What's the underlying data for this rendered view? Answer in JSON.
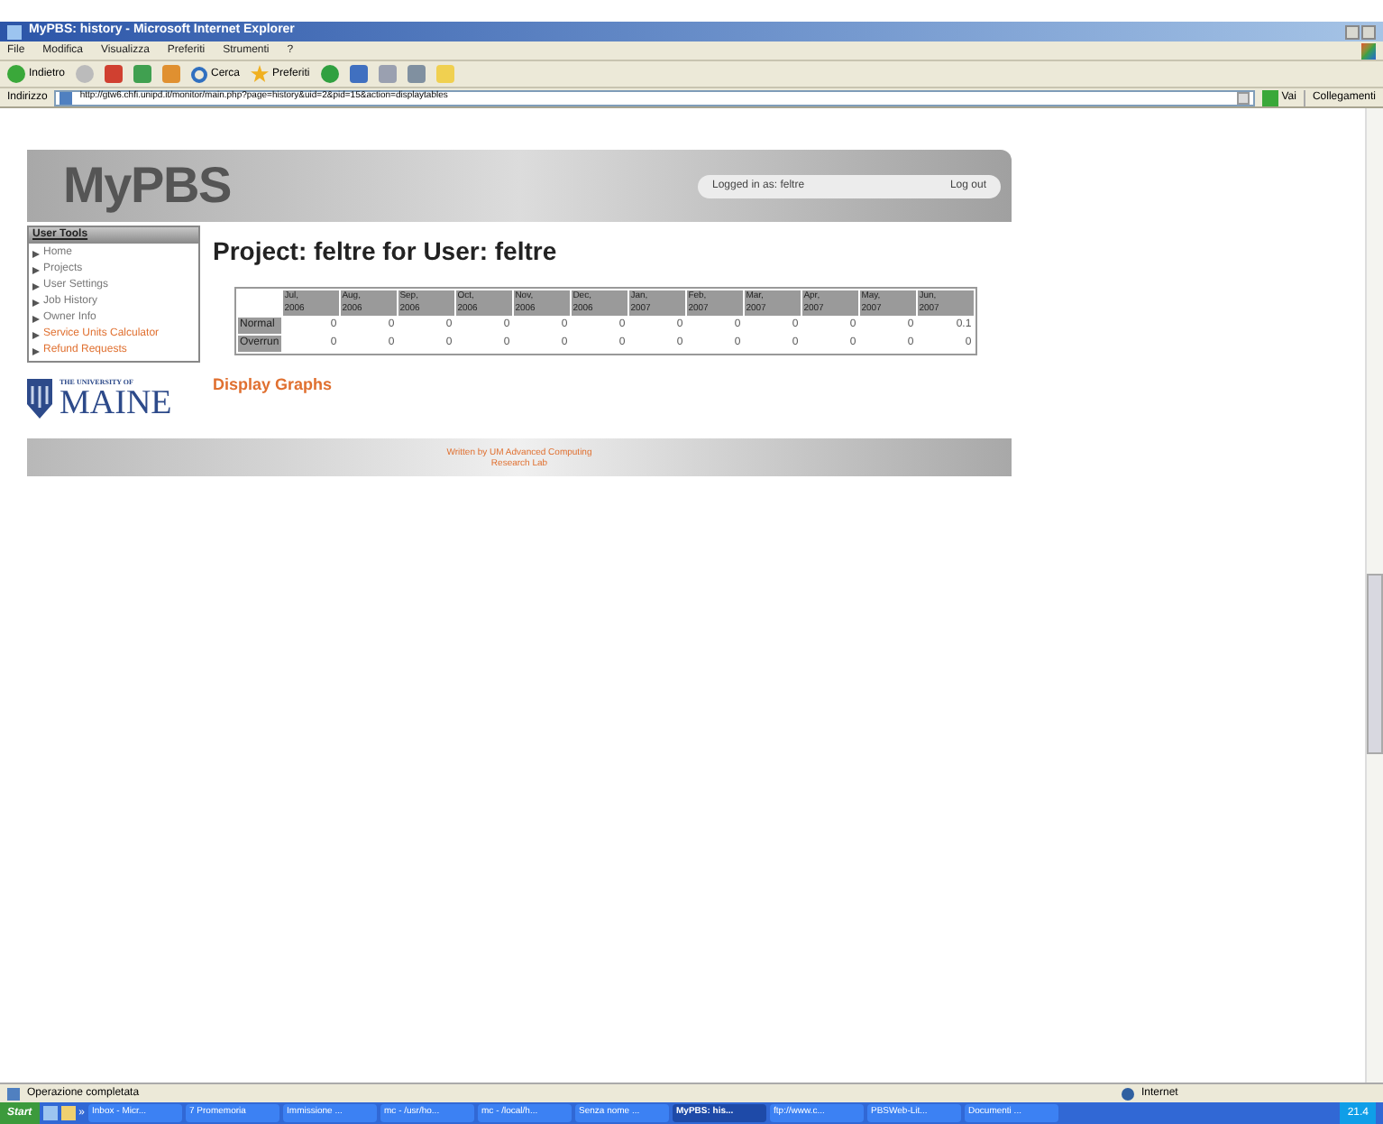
{
  "window": {
    "title": "MyPBS: history - Microsoft Internet Explorer"
  },
  "menu": [
    "File",
    "Modifica",
    "Visualizza",
    "Preferiti",
    "Strumenti",
    "?"
  ],
  "toolbar": {
    "back": "Indietro",
    "search": "Cerca",
    "favorites": "Preferiti"
  },
  "address": {
    "label": "Indirizzo",
    "url": "http://gtw6.chfi.unipd.it/monitor/main.php?page=history&uid=2&pid=15&action=displaytables",
    "go": "Vai",
    "links": "Collegamenti"
  },
  "header": {
    "logo": "MyPBS",
    "logged_in": "Logged in as: feltre",
    "logout": "Log out"
  },
  "sidebar": {
    "title": "User Tools",
    "items": [
      {
        "label": "Home",
        "kind": "normal"
      },
      {
        "label": "Projects",
        "kind": "normal"
      },
      {
        "label": "User Settings",
        "kind": "normal"
      },
      {
        "label": "Job History",
        "kind": "normal"
      },
      {
        "label": "Owner Info",
        "kind": "normal"
      },
      {
        "label": "Service Units Calculator",
        "kind": "accent"
      },
      {
        "label": "Refund Requests",
        "kind": "accent"
      }
    ]
  },
  "university": {
    "line1": "THE UNIVERSITY OF",
    "line2": "MAINE"
  },
  "page_title": "Project: feltre for User: feltre",
  "table": {
    "columns": [
      "Jul, 2006",
      "Aug, 2006",
      "Sep, 2006",
      "Oct, 2006",
      "Nov, 2006",
      "Dec, 2006",
      "Jan, 2007",
      "Feb, 2007",
      "Mar, 2007",
      "Apr, 2007",
      "May, 2007",
      "Jun, 2007"
    ],
    "rows": [
      {
        "label": "Normal",
        "cells": [
          "0",
          "0",
          "0",
          "0",
          "0",
          "0",
          "0",
          "0",
          "0",
          "0",
          "0",
          "0.1"
        ]
      },
      {
        "label": "Overrun",
        "cells": [
          "0",
          "0",
          "0",
          "0",
          "0",
          "0",
          "0",
          "0",
          "0",
          "0",
          "0",
          "0"
        ]
      }
    ]
  },
  "display_graphs": "Display Graphs",
  "footer": [
    "Written by UM Advanced Computing",
    "Research Lab"
  ],
  "status_bar": {
    "text": "Operazione completata",
    "zone": "Internet"
  },
  "taskbar": {
    "start": "Start",
    "more": "»",
    "items": [
      {
        "label": "Inbox - Micr...",
        "selected": false
      },
      {
        "label": "7 Promemoria",
        "selected": false
      },
      {
        "label": "Immissione ...",
        "selected": false
      },
      {
        "label": "mc - /usr/ho...",
        "selected": false
      },
      {
        "label": "mc - /local/h...",
        "selected": false
      },
      {
        "label": "Senza nome ...",
        "selected": false
      },
      {
        "label": "MyPBS: his...",
        "selected": true
      },
      {
        "label": "ftp://www.c...",
        "selected": false
      },
      {
        "label": "PBSWeb-Lit...",
        "selected": false
      },
      {
        "label": "Documenti ...",
        "selected": false
      }
    ],
    "clock": "21.4"
  }
}
